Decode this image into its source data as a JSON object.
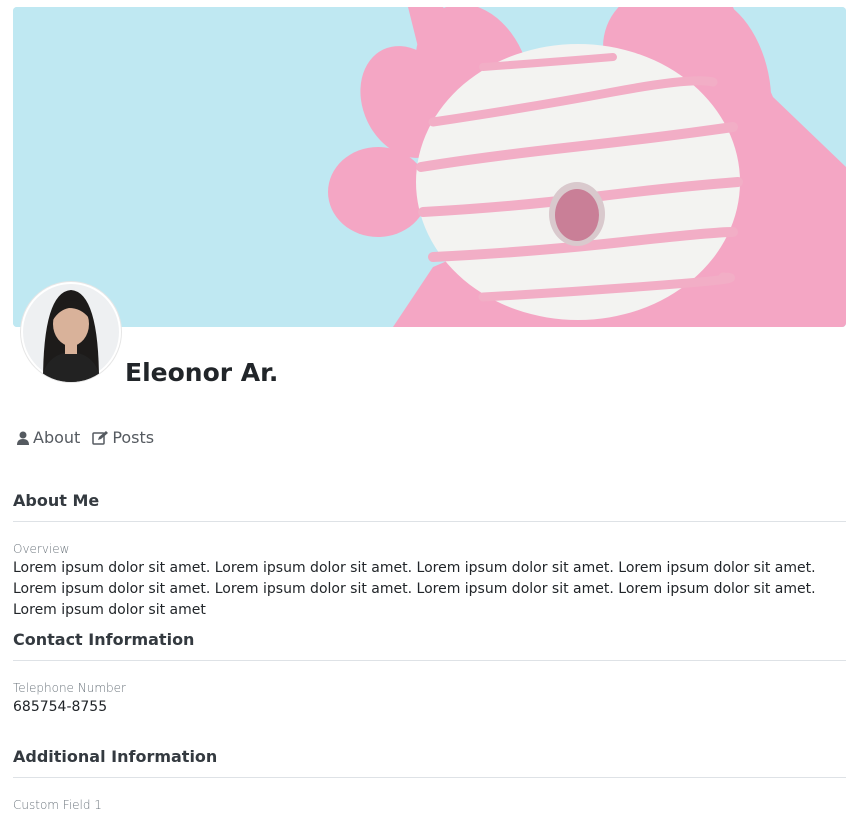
{
  "profile": {
    "name": "Eleonor Ar."
  },
  "tabs": [
    {
      "label": "About",
      "icon": "user-icon"
    },
    {
      "label": "Posts",
      "icon": "edit-icon"
    }
  ],
  "sections": {
    "about": {
      "title": "About Me",
      "fields": [
        {
          "label": "Overview",
          "value": "Lorem ipsum dolor sit amet. Lorem ipsum dolor sit amet. Lorem ipsum dolor sit amet. Lorem ipsum dolor sit amet. Lorem ipsum dolor sit amet. Lorem ipsum dolor sit amet. Lorem ipsum dolor sit amet. Lorem ipsum dolor sit amet. Lorem ipsum dolor sit amet"
        }
      ]
    },
    "contact": {
      "title": "Contact Information",
      "fields": [
        {
          "label": "Telephone Number",
          "value": "685754-8755"
        }
      ]
    },
    "additional": {
      "title": "Additional Information",
      "fields": [
        {
          "label": "Custom Field 1",
          "value": ""
        }
      ]
    }
  },
  "colors": {
    "cover_background": "#bfe8f2",
    "glove": "#f4a6c4",
    "donut": "#f3f3f1",
    "icing_stripes": "#f2aec6"
  }
}
